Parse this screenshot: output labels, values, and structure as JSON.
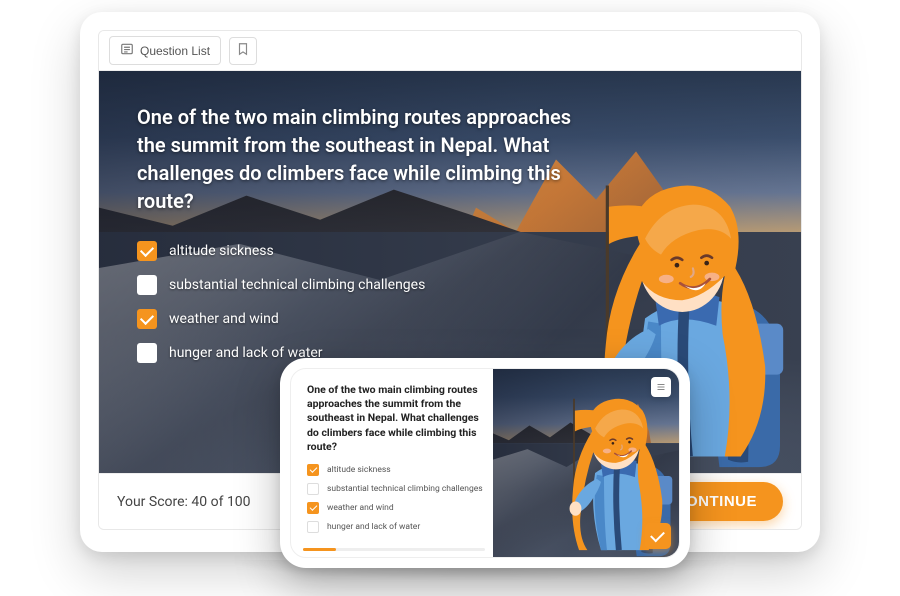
{
  "toolbar": {
    "question_list_label": "Question List"
  },
  "question": {
    "text": "One of the two main climbing routes approaches the summit from the  southeast in Nepal. What challenges do climbers face while climbing this route?",
    "options": [
      {
        "label": "altitude sickness",
        "checked": true
      },
      {
        "label": "substantial technical climbing challenges",
        "checked": false
      },
      {
        "label": "weather and wind",
        "checked": true
      },
      {
        "label": "hunger and lack of water",
        "checked": false
      }
    ]
  },
  "footer": {
    "score_text": "Your Score: 40 of 100",
    "continue_label": "CONTINUE"
  },
  "mobile": {
    "question_text": "One of the two main climbing routes approaches the summit from the southeast in Nepal. What challenges do climbers face while climbing this route?",
    "options": [
      {
        "label": "altitude sickness",
        "checked": true
      },
      {
        "label": "substantial technical climbing challenges",
        "checked": false
      },
      {
        "label": "weather and wind",
        "checked": true
      },
      {
        "label": "hunger and lack of water",
        "checked": false
      }
    ]
  },
  "colors": {
    "accent": "#f5941e"
  }
}
